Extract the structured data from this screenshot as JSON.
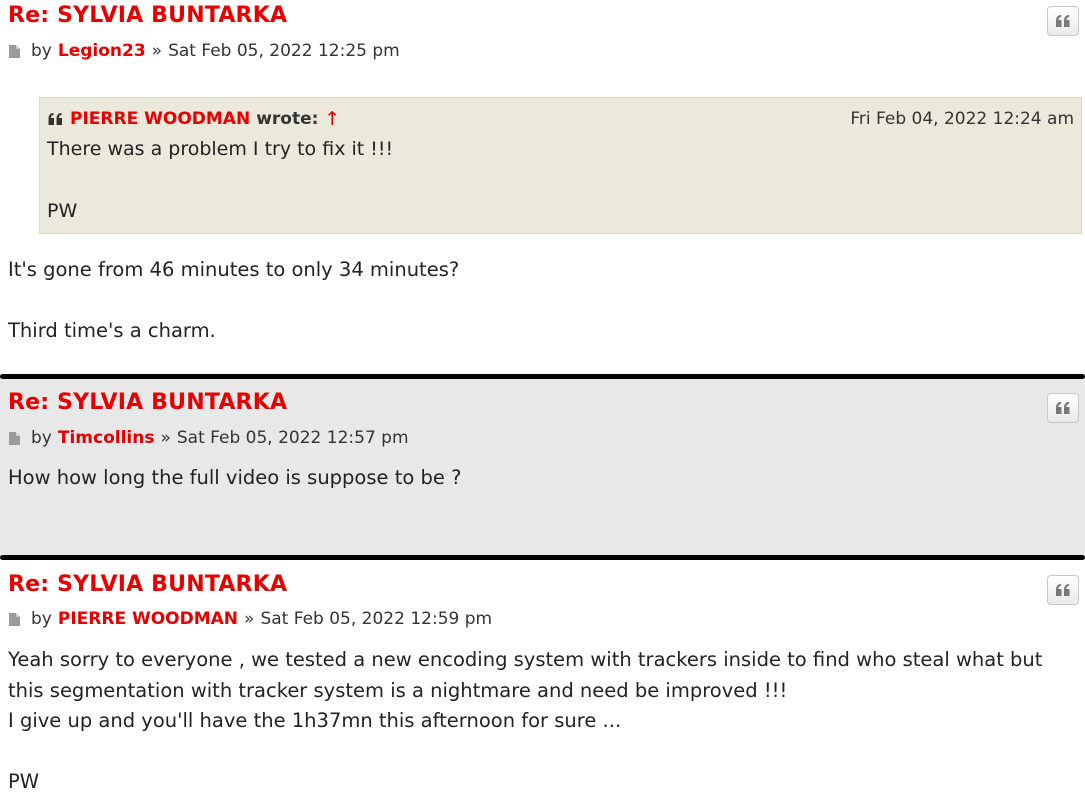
{
  "posts": [
    {
      "title": "Re: SYLVIA BUNTARKA",
      "by": "by",
      "author": "Legion23",
      "raquo": "»",
      "date": "Sat Feb 05, 2022 12:25 pm",
      "quote": {
        "author": "PIERRE WOODMAN",
        "wrote": "wrote:",
        "arrow": "↑",
        "date": "Fri Feb 04, 2022 12:24 am",
        "lines": [
          "There was a problem I try to fix it !!!",
          "PW"
        ]
      },
      "lines": [
        "It's gone from 46 minutes to only 34 minutes?",
        "Third time's a charm."
      ]
    },
    {
      "title": "Re: SYLVIA BUNTARKA",
      "by": "by",
      "author": "Timcollins",
      "raquo": "»",
      "date": "Sat Feb 05, 2022 12:57 pm",
      "lines": [
        "How how long the full video is suppose to be ?"
      ]
    },
    {
      "title": "Re: SYLVIA BUNTARKA",
      "by": "by",
      "author": "PIERRE WOODMAN",
      "raquo": "»",
      "date": "Sat Feb 05, 2022 12:59 pm",
      "lines": [
        "Yeah sorry to everyone , we tested a new encoding system with trackers inside to find who steal what but",
        "this segmentation with tracker system is a nightmare and need be improved !!!",
        "I give up and you'll have the 1h37mn this afternoon for sure ...",
        "PW"
      ]
    }
  ],
  "icons": {
    "quote_button": "quote-icon",
    "post_link": "document-icon",
    "cite": "quote-icon"
  },
  "colors": {
    "accent": "#e60000",
    "quote_bg": "#ebe8dc",
    "alt_post_bg": "#e8e8e8"
  }
}
